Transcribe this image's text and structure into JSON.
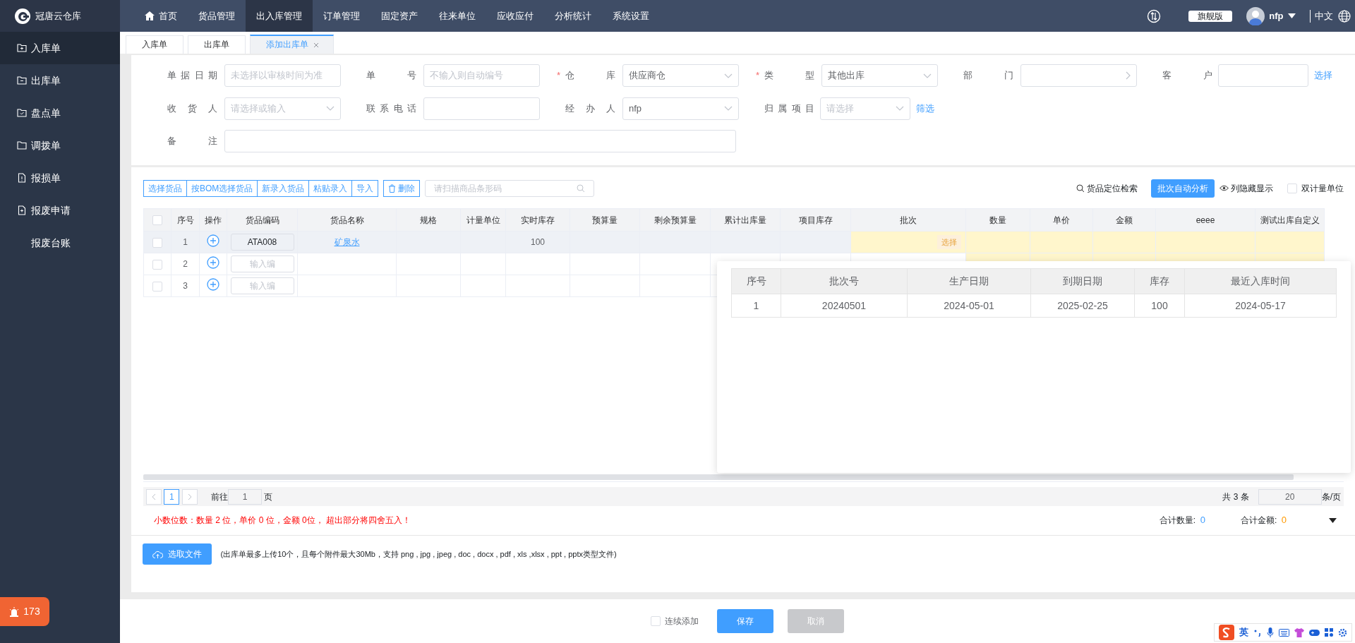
{
  "app": {
    "logo_text": "冠唐云仓库"
  },
  "top_nav": [
    {
      "label": "首页",
      "home": true,
      "selected": false
    },
    {
      "label": "货品管理",
      "home": false,
      "selected": false
    },
    {
      "label": "出入库管理",
      "home": false,
      "selected": true
    },
    {
      "label": "订单管理",
      "home": false,
      "selected": false
    },
    {
      "label": "固定资产",
      "home": false,
      "selected": false
    },
    {
      "label": "往来单位",
      "home": false,
      "selected": false
    },
    {
      "label": "应收应付",
      "home": false,
      "selected": false
    },
    {
      "label": "分析统计",
      "home": false,
      "selected": false
    },
    {
      "label": "系统设置",
      "home": false,
      "selected": false
    }
  ],
  "header_right": {
    "edition": "旗舰版",
    "user": "nfp",
    "language": "中文"
  },
  "sidebar": {
    "items": [
      {
        "label": "入库单",
        "icon": true,
        "selected": true
      },
      {
        "label": "出库单",
        "icon": true,
        "selected": false
      },
      {
        "label": "盘点单",
        "icon": true,
        "selected": false
      },
      {
        "label": "调拨单",
        "icon": true,
        "selected": false
      },
      {
        "label": "报损单",
        "icon": true,
        "selected": false
      },
      {
        "label": "报废申请",
        "icon": true,
        "selected": false
      },
      {
        "label": "报废台账",
        "icon": false,
        "selected": false
      }
    ]
  },
  "alarm_badge": {
    "count": "173"
  },
  "tabs": [
    {
      "label": "入库单",
      "selected": false,
      "closable": false
    },
    {
      "label": "出库单",
      "selected": false,
      "closable": false
    },
    {
      "label": "添加出库单",
      "selected": true,
      "closable": true
    }
  ],
  "form": {
    "rows": [
      [
        {
          "label": "单据日期",
          "kind": "input",
          "placeholder": "未选择以审核时间为准"
        },
        {
          "label": "单号",
          "kind": "input",
          "placeholder": "不输入则自动编号"
        },
        {
          "label": "仓库",
          "kind": "select",
          "value": "供应商仓",
          "required_mark": "*"
        },
        {
          "label": "类型",
          "kind": "select",
          "value": "其他出库",
          "required_mark": "*"
        },
        {
          "label": "部门",
          "kind": "cascader"
        },
        {
          "label": "客户",
          "kind": "input",
          "link": "选择"
        }
      ],
      [
        {
          "label": "收货人",
          "kind": "select",
          "placeholder": "请选择或输入"
        },
        {
          "label": "联系电话",
          "kind": "input"
        },
        {
          "label": "经办人",
          "kind": "select",
          "value": "nfp"
        },
        {
          "label": "归属项目",
          "kind": "select",
          "placeholder": "请选择",
          "link": "筛选"
        }
      ],
      [
        {
          "label": "备注",
          "kind": "wide"
        }
      ]
    ]
  },
  "toolbar": {
    "buttons": [
      "选择货品",
      "按BOM选择货品",
      "新录入货品",
      "粘贴录入",
      "导入"
    ],
    "delete": "删除",
    "scan_placeholder": "请扫描商品条形码",
    "locate": "货品定位检索",
    "auto_batch": "批次自动分析",
    "toggle_columns": "列隐藏显示",
    "dual_unit": {
      "label": "双计量单位",
      "checked": false
    }
  },
  "table": {
    "select_all_checked": false,
    "columns": [
      {
        "label": "序号",
        "editable": false
      },
      {
        "label": "操作",
        "editable": false
      },
      {
        "label": "货品编码",
        "editable": false
      },
      {
        "label": "货品名称",
        "editable": false
      },
      {
        "label": "规格",
        "editable": false
      },
      {
        "label": "计量单位",
        "editable": false
      },
      {
        "label": "实时库存",
        "editable": false
      },
      {
        "label": "预算量",
        "editable": false
      },
      {
        "label": "剩余预算量",
        "editable": false
      },
      {
        "label": "累计出库量",
        "editable": false
      },
      {
        "label": "项目库存",
        "editable": false
      },
      {
        "label": "批次",
        "editable": false
      },
      {
        "label": "数量",
        "editable": true
      },
      {
        "label": "单价",
        "editable": true
      },
      {
        "label": "金额",
        "editable": true
      },
      {
        "label": "eeee",
        "editable": true
      },
      {
        "label": "测试出库自定义",
        "editable": true
      }
    ],
    "rows": [
      {
        "no": "1",
        "checked": false,
        "hover": true,
        "code": "ATA008",
        "name": "矿泉水",
        "stock": "100",
        "batch_button": "选择"
      },
      {
        "no": "2",
        "checked": false,
        "hover": false,
        "code_placeholder": "输入编"
      },
      {
        "no": "3",
        "checked": false,
        "hover": false,
        "code_placeholder": "输入编"
      }
    ]
  },
  "batch_popover": {
    "columns": [
      "序号",
      "批次号",
      "生产日期",
      "到期日期",
      "库存",
      "最近入库时间"
    ],
    "rows": [
      [
        "1",
        "20240501",
        "2024-05-01",
        "2025-02-25",
        "100",
        "2024-05-17"
      ]
    ]
  },
  "pagination": {
    "pages": [
      {
        "label": "1",
        "selected": true
      }
    ],
    "goto_label": "前往",
    "goto_value": "1",
    "page_suffix": "页",
    "total": "共 3 条",
    "page_size": "20",
    "page_size_suffix": "条/页"
  },
  "summary": {
    "note": "小数位数：数量 2 位，单价 0 位，金额 0位， 超出部分将四舍五入！",
    "qty_label": "合计数量:",
    "qty": "0",
    "amount_label": "合计金额:",
    "amount": "0"
  },
  "attachments": {
    "button": "选取文件",
    "hint": "(出库单最多上传10个，且每个附件最大30Mb，支持 png , jpg , jpeg , doc , docx , pdf , xls ,xlsx , ppt , pptx类型文件)"
  },
  "footer": {
    "continuous": {
      "label": "连续添加",
      "checked": false
    },
    "save": "保存",
    "cancel": "取消",
    "cancel_disabled": true
  },
  "ime_toolbar": {
    "mode": "英"
  }
}
